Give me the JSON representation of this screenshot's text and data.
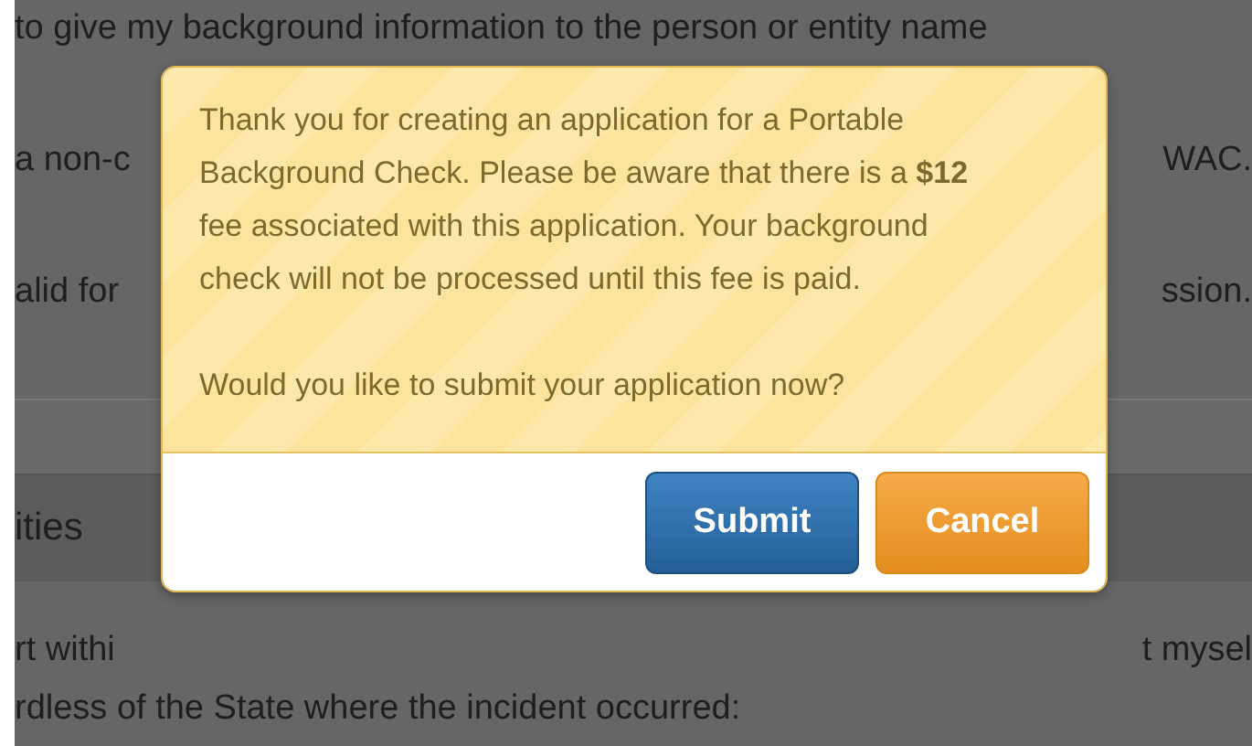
{
  "background": {
    "rows": [
      {
        "left": "to give my background information to the person or entity name",
        "right": ""
      },
      {
        "left": "a non-c",
        "right": "WAC."
      },
      {
        "left": "alid for",
        "right": "ssion."
      },
      {
        "left": "ities",
        "right": "",
        "kind": "heading"
      },
      {
        "left": "rt withi",
        "right": "t mysel"
      },
      {
        "left": "rdless of the State where the incident occurred:",
        "right": ""
      }
    ]
  },
  "dialog": {
    "message": "Thank you for creating an application for a Portable Background Check. Please be aware that there is a **$12** fee associated with this application. Your background check will not be processed until this fee is paid.",
    "question": "Would you like to submit your application now?",
    "buttons": [
      {
        "label": "Submit",
        "kind": "primary"
      },
      {
        "label": "Cancel",
        "kind": "warning"
      }
    ]
  }
}
